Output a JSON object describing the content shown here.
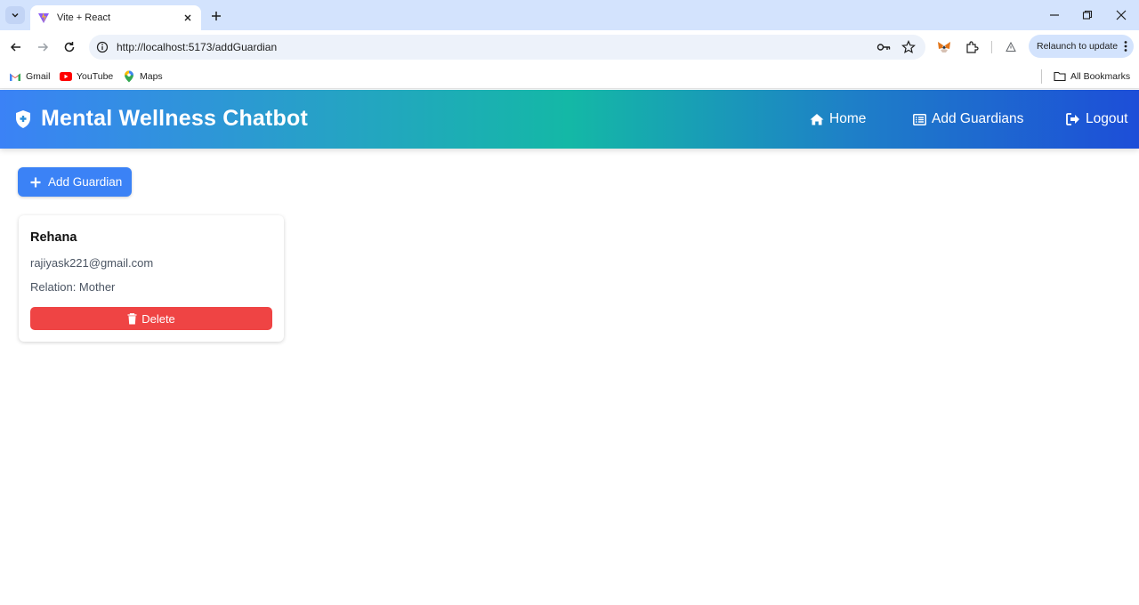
{
  "browser": {
    "tab_title": "Vite + React",
    "url": "http://localhost:5173/addGuardian",
    "relaunch_label": "Relaunch to update",
    "bookmarks": [
      {
        "label": "Gmail",
        "icon": "gmail-icon"
      },
      {
        "label": "YouTube",
        "icon": "youtube-icon"
      },
      {
        "label": "Maps",
        "icon": "maps-icon"
      }
    ],
    "all_bookmarks_label": "All Bookmarks"
  },
  "header": {
    "title": "Mental Wellness Chatbot",
    "brand_icon": "shield-plus-icon",
    "nav": [
      {
        "label": "Home",
        "icon": "home-icon"
      },
      {
        "label": "Add Guardians",
        "icon": "list-icon"
      },
      {
        "label": "Logout",
        "icon": "logout-icon"
      }
    ]
  },
  "actions": {
    "add_label": "Add Guardian"
  },
  "guardians": [
    {
      "name": "Rehana",
      "email": "rajiyask221@gmail.com",
      "relation": "Relation: Mother",
      "delete_label": "Delete"
    }
  ],
  "colors": {
    "primary": "#3b82f6",
    "danger": "#ef4444",
    "header_gradient": [
      "#3b82f6",
      "#14b8a6",
      "#1d4ed8"
    ]
  }
}
